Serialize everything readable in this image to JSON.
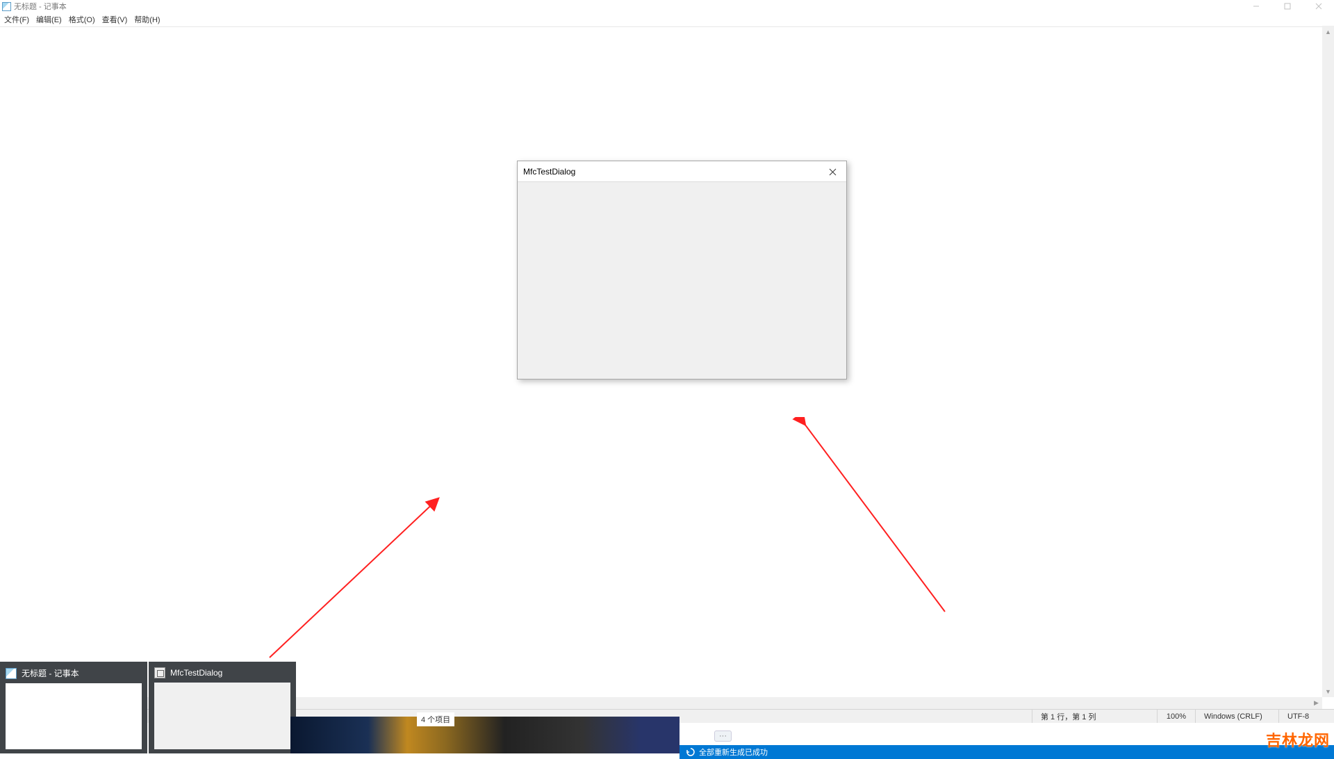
{
  "notepad": {
    "title": "无标题 - 记事本",
    "menu": {
      "file": "文件(F)",
      "edit": "编辑(E)",
      "format": "格式(O)",
      "view": "查看(V)",
      "help": "帮助(H)"
    },
    "status": {
      "position": "第 1 行，第 1 列",
      "zoom": "100%",
      "line_ending": "Windows (CRLF)",
      "encoding": "UTF-8"
    }
  },
  "dialog": {
    "title": "MfcTestDialog"
  },
  "task_previews": {
    "item1": {
      "title": "无标题 - 记事本"
    },
    "item2": {
      "title": "MfcTestDialog"
    }
  },
  "bottom": {
    "items_count": "4 个项目",
    "build_status": "全部重新生成已成功"
  },
  "watermark": "吉林龙网"
}
